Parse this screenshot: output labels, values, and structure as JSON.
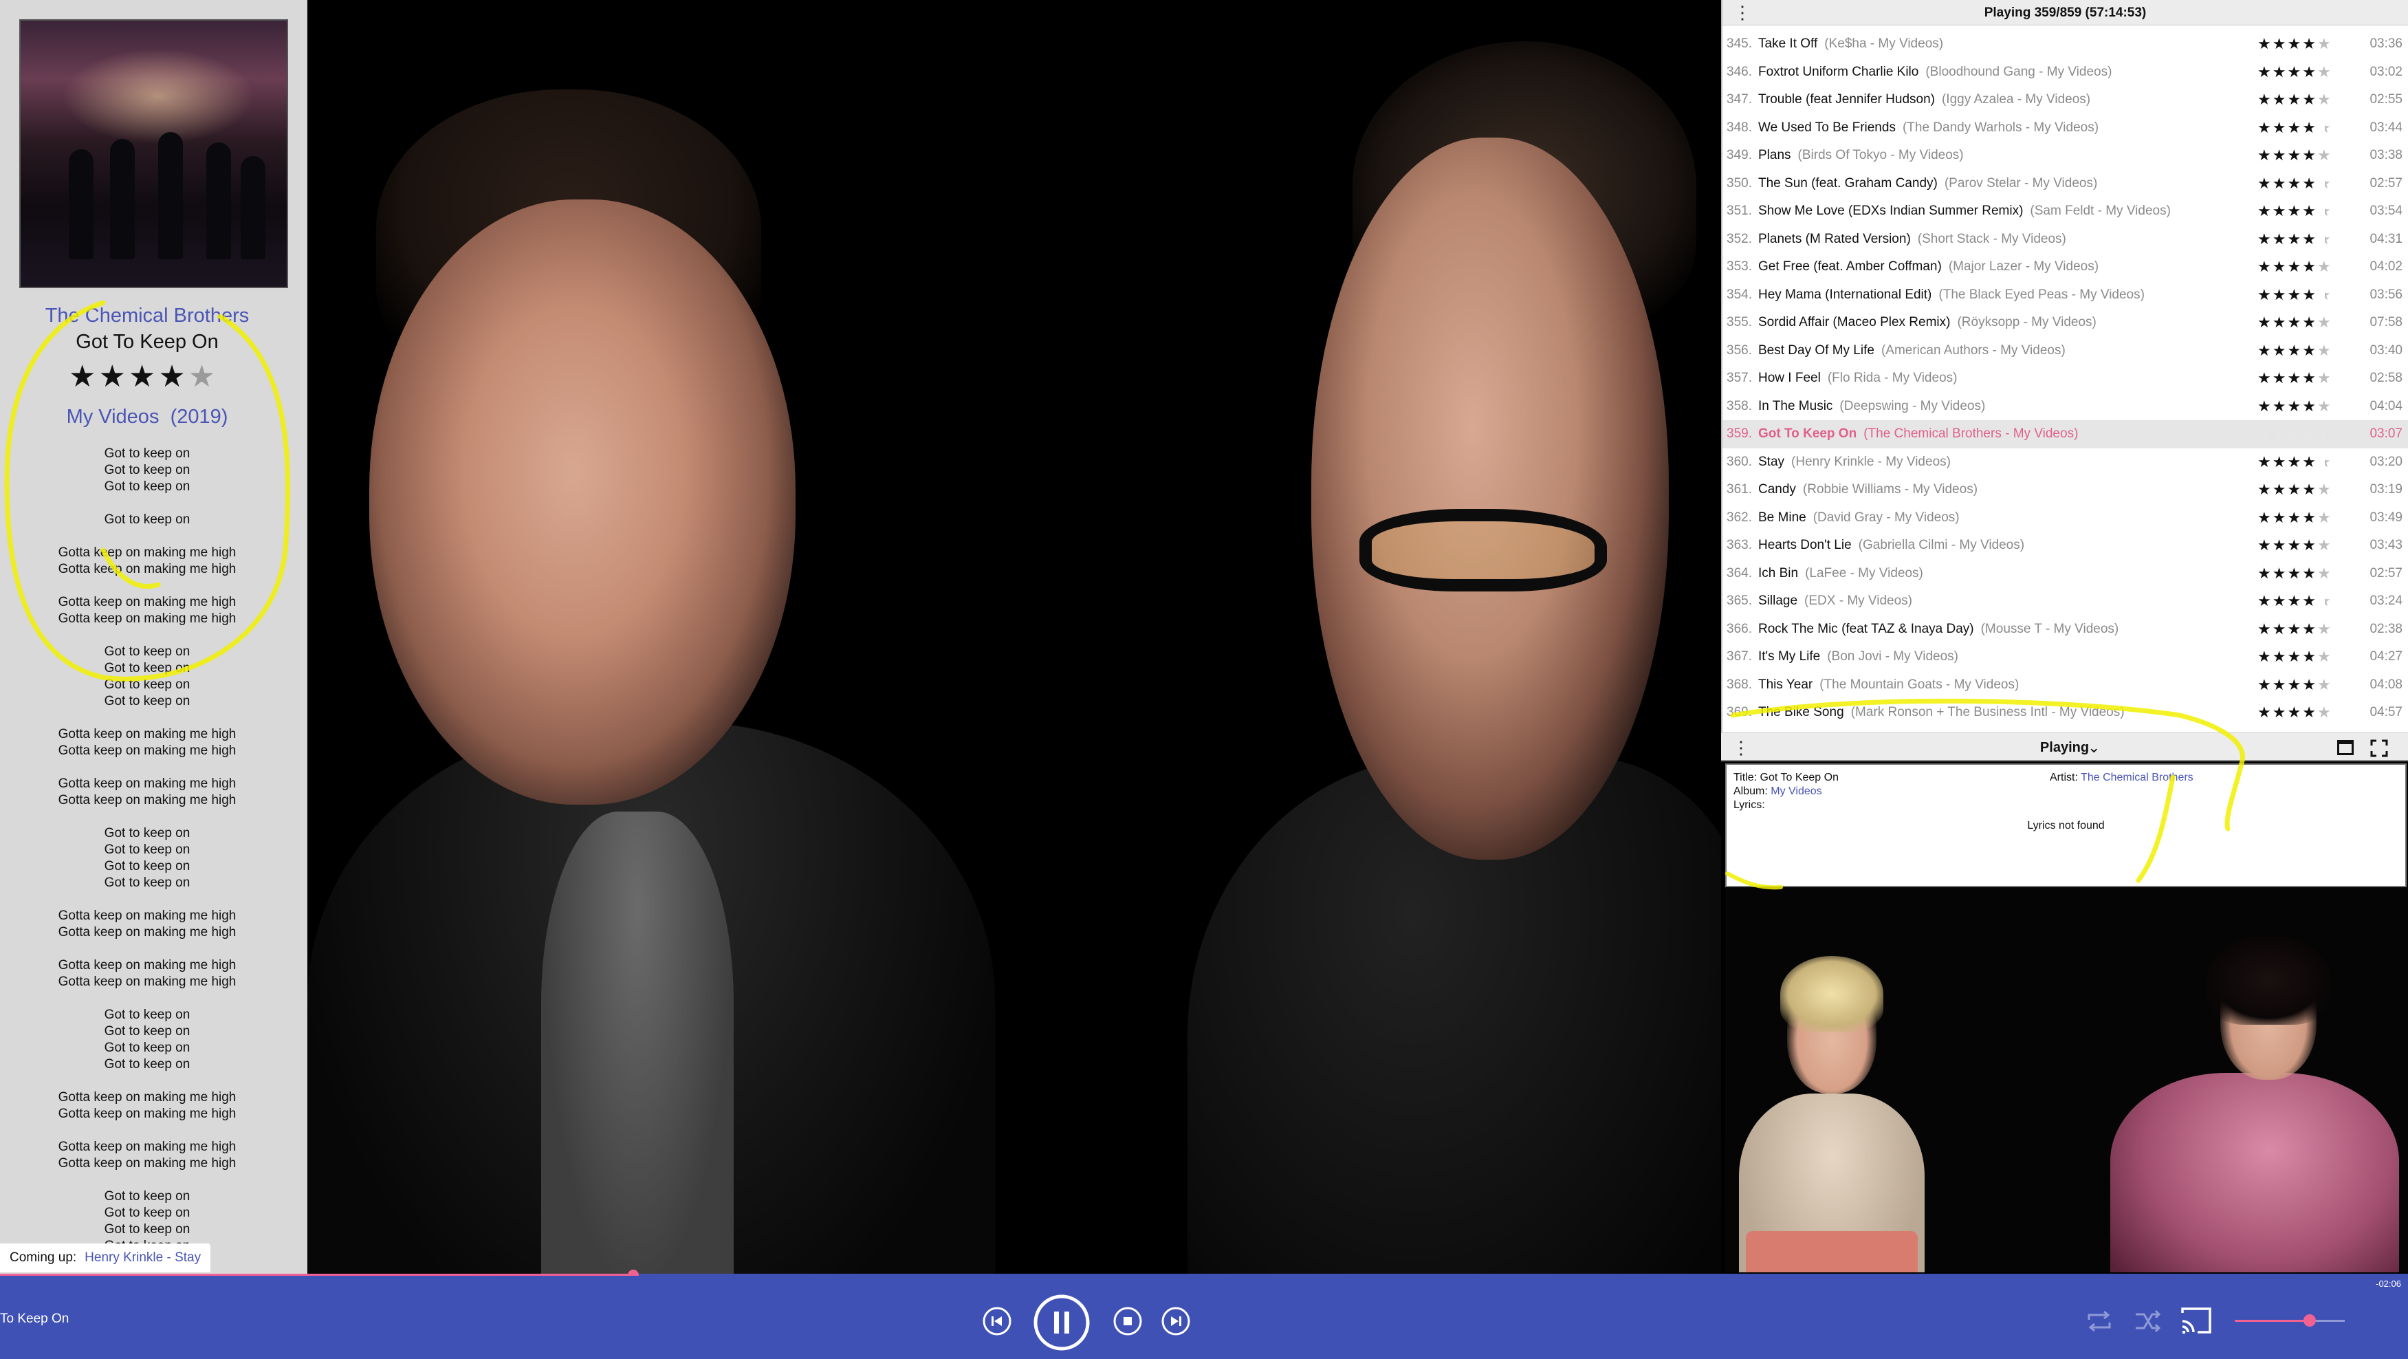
{
  "left_panel": {
    "artist": "The Chemical Brothers",
    "title": "Got To Keep On",
    "rating_stars_full": "★★★★",
    "rating_stars_half": "★",
    "rating": 4.5,
    "album": "My Videos",
    "year": "(2019)",
    "lyrics": [
      "Got to keep on",
      "Got to keep on",
      "Got to keep on",
      "",
      "Got to keep on",
      "",
      "Gotta keep on making me high",
      "Gotta keep on making me high",
      "",
      "Gotta keep on making me high",
      "Gotta keep on making me high",
      "",
      "Got to keep on",
      "Got to keep on",
      "Got to keep on",
      "Got to keep on",
      "",
      "Gotta keep on making me high",
      "Gotta keep on making me high",
      "",
      "Gotta keep on making me high",
      "Gotta keep on making me high",
      "",
      "Got to keep on",
      "Got to keep on",
      "Got to keep on",
      "Got to keep on",
      "",
      "Gotta keep on making me high",
      "Gotta keep on making me high",
      "",
      "Gotta keep on making me high",
      "Gotta keep on making me high",
      "",
      "Got to keep on",
      "Got to keep on",
      "Got to keep on",
      "Got to keep on",
      "",
      "Gotta keep on making me high",
      "Gotta keep on making me high",
      "",
      "Gotta keep on making me high",
      "Gotta keep on making me high",
      "",
      "Got to keep on",
      "Got to keep on",
      "Got to keep on",
      "Got to keep on"
    ],
    "coming_up_label": "Coming up:",
    "coming_up_value": "Henry Krinkle - Stay"
  },
  "playlist": {
    "header": "Playing 359/859 (57:14:53)",
    "rows": [
      {
        "num": "345.",
        "title": "Take It Off",
        "meta": "(Ke$ha - My Videos)",
        "rating": 4,
        "dur": "03:36"
      },
      {
        "num": "346.",
        "title": "Foxtrot Uniform Charlie Kilo",
        "meta": "(Bloodhound Gang - My Videos)",
        "rating": 4,
        "dur": "03:02"
      },
      {
        "num": "347.",
        "title": "Trouble (feat Jennifer Hudson)",
        "meta": "(Iggy Azalea - My Videos)",
        "rating": 4,
        "dur": "02:55"
      },
      {
        "num": "348.",
        "title": "We Used To Be Friends",
        "meta": "(The Dandy Warhols - My Videos)",
        "rating": 4.5,
        "dur": "03:44"
      },
      {
        "num": "349.",
        "title": "Plans",
        "meta": "(Birds Of Tokyo - My Videos)",
        "rating": 4,
        "dur": "03:38"
      },
      {
        "num": "350.",
        "title": "The Sun (feat. Graham Candy)",
        "meta": "(Parov Stelar - My Videos)",
        "rating": 4.5,
        "dur": "02:57"
      },
      {
        "num": "351.",
        "title": "Show Me Love (EDXs Indian Summer Remix)",
        "meta": "(Sam Feldt - My Videos)",
        "rating": 4.5,
        "dur": "03:54"
      },
      {
        "num": "352.",
        "title": "Planets (M Rated Version)",
        "meta": "(Short Stack - My Videos)",
        "rating": 4.5,
        "dur": "04:31"
      },
      {
        "num": "353.",
        "title": "Get Free (feat. Amber Coffman)",
        "meta": "(Major Lazer - My Videos)",
        "rating": 4,
        "dur": "04:02"
      },
      {
        "num": "354.",
        "title": "Hey Mama (International Edit)",
        "meta": "(The Black Eyed Peas - My Videos)",
        "rating": 4.5,
        "dur": "03:56"
      },
      {
        "num": "355.",
        "title": "Sordid Affair (Maceo Plex Remix)",
        "meta": "(Röyksopp - My Videos)",
        "rating": 4,
        "dur": "07:58"
      },
      {
        "num": "356.",
        "title": "Best Day Of My Life",
        "meta": "(American Authors - My Videos)",
        "rating": 4,
        "dur": "03:40"
      },
      {
        "num": "357.",
        "title": "How I Feel",
        "meta": "(Flo Rida - My Videos)",
        "rating": 4,
        "dur": "02:58"
      },
      {
        "num": "358.",
        "title": "In The Music",
        "meta": "(Deepswing - My Videos)",
        "rating": 4,
        "dur": "04:04"
      },
      {
        "num": "359.",
        "title": "Got To Keep On",
        "meta": "(The Chemical Brothers - My Videos)",
        "rating": 4.5,
        "dur": "03:07",
        "current": true
      },
      {
        "num": "360.",
        "title": "Stay",
        "meta": "(Henry Krinkle - My Videos)",
        "rating": 4.5,
        "dur": "03:20"
      },
      {
        "num": "361.",
        "title": "Candy",
        "meta": "(Robbie Williams - My Videos)",
        "rating": 4,
        "dur": "03:19"
      },
      {
        "num": "362.",
        "title": "Be Mine",
        "meta": "(David Gray - My Videos)",
        "rating": 4,
        "dur": "03:49"
      },
      {
        "num": "363.",
        "title": "Hearts Don't Lie",
        "meta": "(Gabriella Cilmi - My Videos)",
        "rating": 4,
        "dur": "03:43"
      },
      {
        "num": "364.",
        "title": "Ich Bin",
        "meta": "(LaFee - My Videos)",
        "rating": 4,
        "dur": "02:57"
      },
      {
        "num": "365.",
        "title": "Sillage",
        "meta": "(EDX - My Videos)",
        "rating": 4.5,
        "dur": "03:24"
      },
      {
        "num": "366.",
        "title": "Rock The Mic (feat TAZ & Inaya Day)",
        "meta": "(Mousse T - My Videos)",
        "rating": 4,
        "dur": "02:38"
      },
      {
        "num": "367.",
        "title": "It's My Life",
        "meta": "(Bon Jovi - My Videos)",
        "rating": 4,
        "dur": "04:27"
      },
      {
        "num": "368.",
        "title": "This Year",
        "meta": "(The Mountain Goats - My Videos)",
        "rating": 4,
        "dur": "04:08"
      },
      {
        "num": "369.",
        "title": "The Bike Song",
        "meta": "(Mark Ronson + The Business Intl - My Videos)",
        "rating": 4,
        "dur": "04:57"
      }
    ]
  },
  "playing_bar": {
    "label": "Playing",
    "chevron": "⌄"
  },
  "info_panel": {
    "title_label": "Title:",
    "title_value": "Got To Keep On",
    "album_label": "Album:",
    "album_value": "My Videos",
    "lyrics_label": "Lyrics:",
    "artist_label": "Artist:",
    "artist_value": "The Chemical Brothers",
    "lyrics_status": "Lyrics not found"
  },
  "player": {
    "now_playing_text": "To Keep On",
    "remaining": "-02:06",
    "progress": 0.263,
    "volume": 0.68,
    "colors": {
      "bar": "#3f51b5",
      "accent": "#f06292",
      "link": "#4a55b5"
    }
  }
}
